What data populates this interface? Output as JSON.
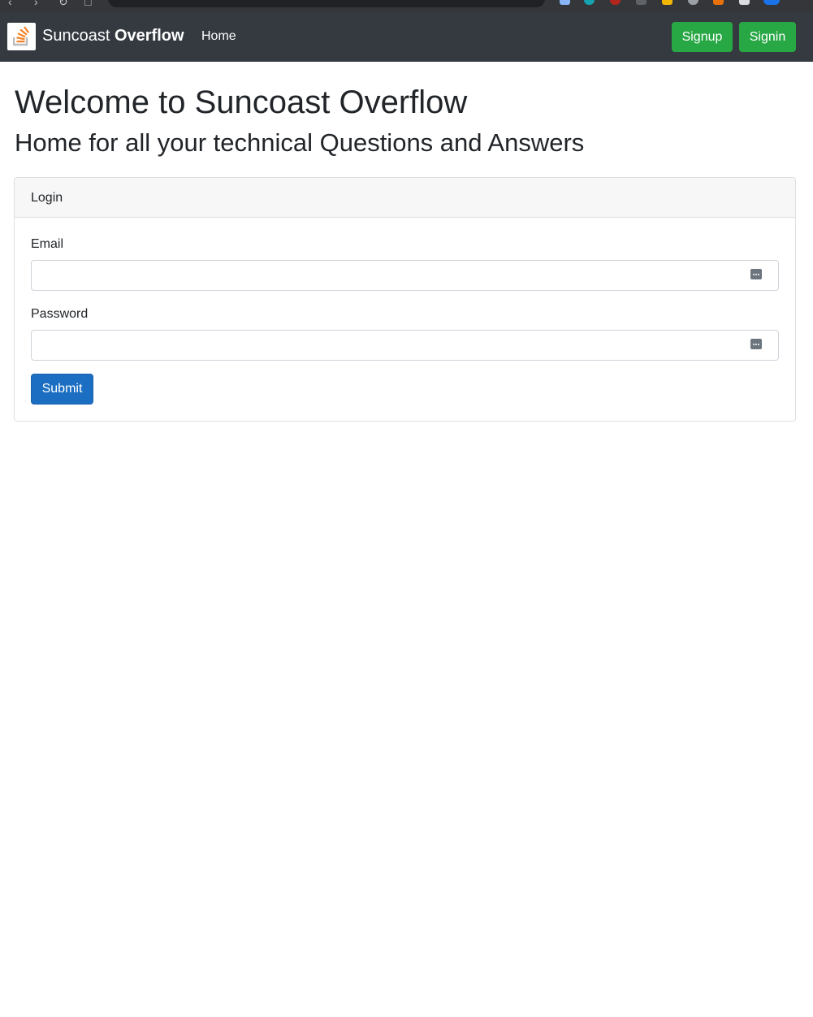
{
  "navbar": {
    "brand_regular": "Suncoast",
    "brand_bold": "Overflow",
    "logo_icon": "stack-overflow-logo-icon",
    "home_link": "Home",
    "signup_label": "Signup",
    "signin_label": "Signin",
    "background_color": "#343a40",
    "button_color": "#28a745"
  },
  "main": {
    "heading": "Welcome to Suncoast Overflow",
    "subheading": "Home for all your technical Questions and Answers"
  },
  "login_card": {
    "header": "Login",
    "email_label": "Email",
    "email_value": "",
    "password_label": "Password",
    "password_value": "",
    "field_icon": "password-manager-key-icon",
    "submit_label": "Submit",
    "submit_color": "#1b6ec2"
  }
}
